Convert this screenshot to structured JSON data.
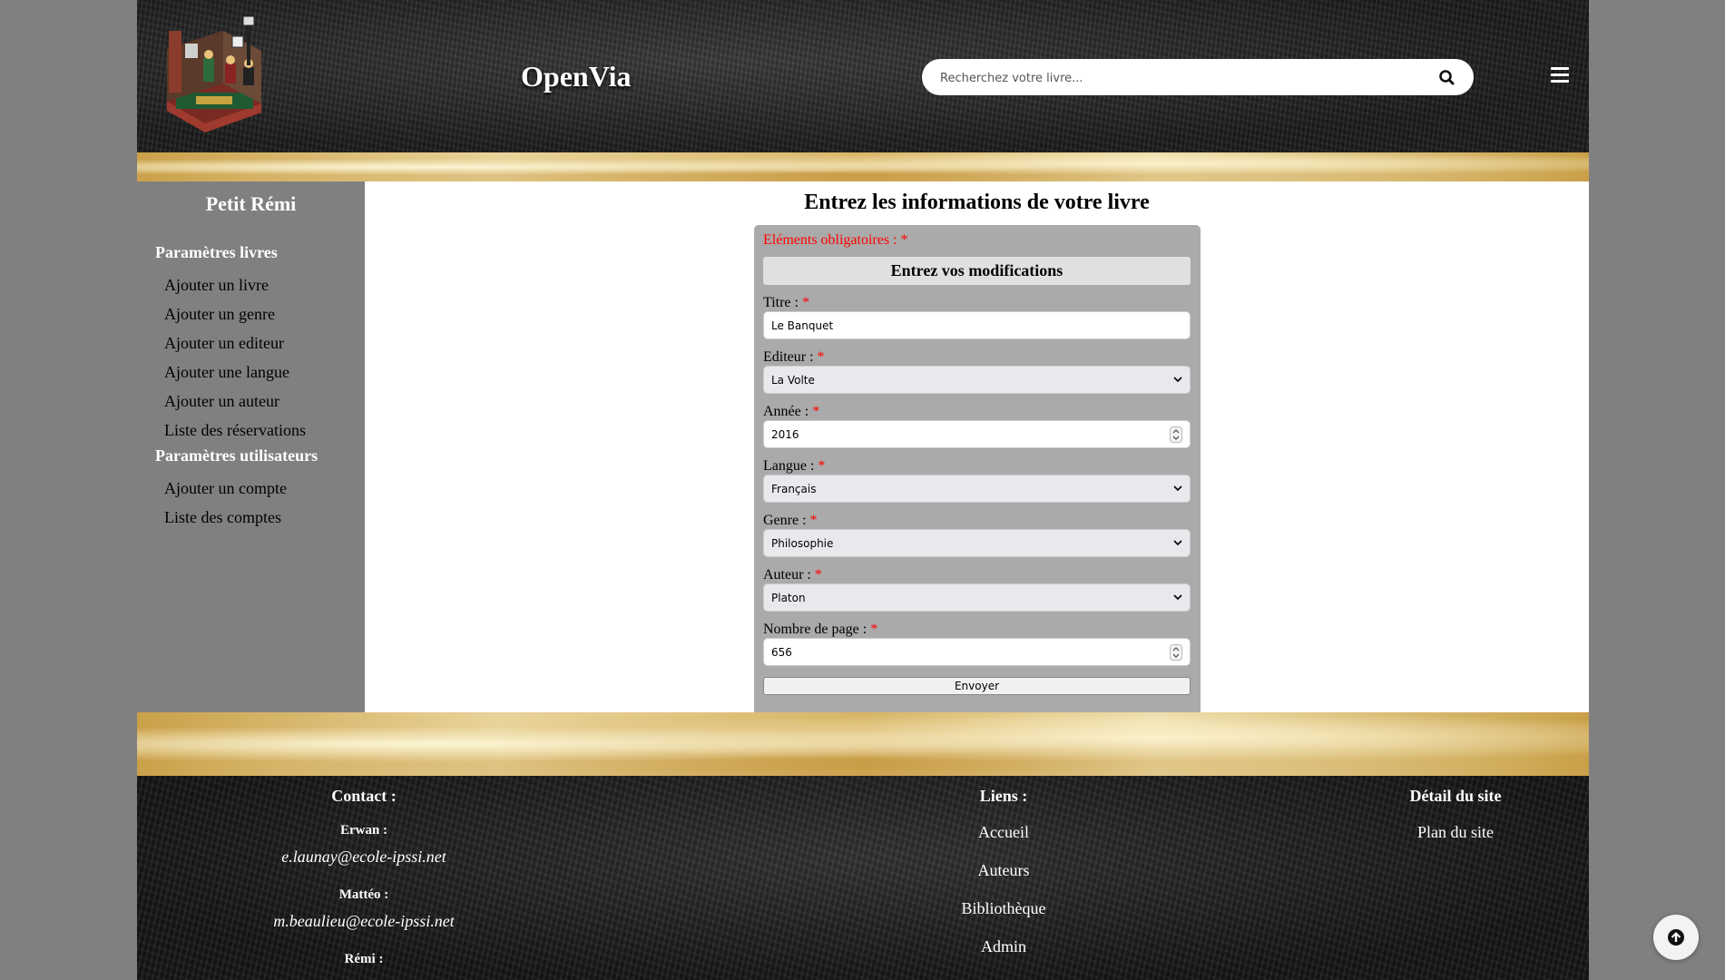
{
  "header": {
    "site_title": "OpenVia",
    "search_placeholder": "Recherchez votre livre...",
    "search_icon": "magnifier-icon",
    "menu_icon": "hamburger-menu-icon",
    "logo": "lego-christmas-carol-logo"
  },
  "sidebar": {
    "user_name": "Petit Rémi",
    "sections": [
      {
        "title": "Paramètres livres",
        "links": [
          "Ajouter un livre",
          "Ajouter un genre",
          "Ajouter un editeur",
          "Ajouter une langue",
          "Ajouter un auteur",
          "Liste des réservations"
        ]
      },
      {
        "title": "Paramètres utilisateurs",
        "links": [
          "Ajouter un compte",
          "Liste des comptes"
        ]
      }
    ]
  },
  "main": {
    "title": "Entrez les informations de votre livre",
    "form": {
      "required_note": "Eléments obligatoires : *",
      "heading": "Entrez vos modifications",
      "fields": {
        "titre": {
          "label": "Titre : ",
          "value": "Le Banquet"
        },
        "editeur": {
          "label": "Editeur : ",
          "value": "La Volte"
        },
        "annee": {
          "label": "Année : ",
          "value": "2016"
        },
        "langue": {
          "label": "Langue : ",
          "value": "Français"
        },
        "genre": {
          "label": "Genre : ",
          "value": "Philosophie"
        },
        "auteur": {
          "label": "Auteur : ",
          "value": "Platon"
        },
        "pages": {
          "label": "Nombre de page : ",
          "value": "656"
        }
      },
      "required_star": "*",
      "submit_label": "Envoyer"
    }
  },
  "footer": {
    "contact": {
      "heading": "Contact :",
      "people": [
        {
          "name": "Erwan :",
          "email": "e.launay@ecole-ipssi.net"
        },
        {
          "name": "Mattéo :",
          "email": "m.beaulieu@ecole-ipssi.net"
        },
        {
          "name": "Rémi :"
        }
      ]
    },
    "links": {
      "heading": "Liens :",
      "items": [
        "Accueil",
        "Auteurs",
        "Bibliothèque",
        "Admin"
      ]
    },
    "site_detail": {
      "heading": "Détail du site",
      "items": [
        "Plan du site"
      ]
    }
  },
  "back_to_top_icon": "arrow-up-circle-icon",
  "colors": {
    "page_bg": "#808080",
    "sidebar_bg": "#808080",
    "form_bg": "#aaaaaa",
    "required": "#ff0000",
    "header_bg": "#262626"
  }
}
